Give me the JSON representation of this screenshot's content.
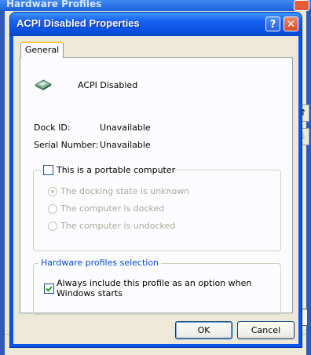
{
  "background_window": {
    "title": "Hardware Profiles"
  },
  "dialog": {
    "title": "ACPI Disabled Properties",
    "help_label": "?",
    "close_label": "✕",
    "tabs": [
      {
        "label": "General"
      }
    ],
    "device": {
      "icon": "dock-device-icon",
      "name": "ACPI Disabled"
    },
    "dock_id": {
      "label": "Dock ID:",
      "value": "Unavailable"
    },
    "serial_number": {
      "label": "Serial Number:",
      "value": "Unavailable"
    },
    "portable": {
      "label": "This is a portable computer",
      "checked": false,
      "options": [
        {
          "label": "The docking state is unknown",
          "selected": true
        },
        {
          "label": "The computer is docked",
          "selected": false
        },
        {
          "label": "The computer is undocked",
          "selected": false
        }
      ]
    },
    "profiles_selection": {
      "title": "Hardware profiles selection",
      "always_include": {
        "label_line1": "Always include this profile as an option when",
        "label_line2": "Windows starts",
        "checked": true
      }
    },
    "buttons": {
      "ok": "OK",
      "cancel": "Cancel"
    }
  },
  "colors": {
    "title_bar": "#0a4fe0",
    "dialog_face": "#ece9d8",
    "tab_highlight": "#ffc83c",
    "group_title": "#0046d5",
    "disabled_text": "#a9a89a"
  }
}
